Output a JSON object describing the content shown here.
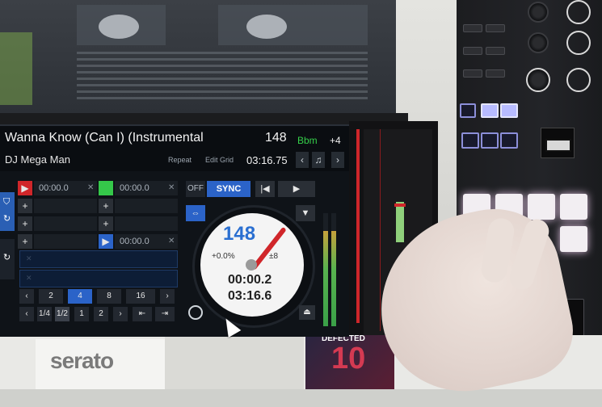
{
  "deck": {
    "track_title": "Wanna Know (Can I) (Instrumental",
    "artist": "DJ Mega Man",
    "bpm": "148",
    "key": "Bbm",
    "key_offset": "+4",
    "repeat_label": "Repeat",
    "edit_grid_label": "Edit Grid",
    "time_remaining": "03:16.75",
    "prev_icon": "‹",
    "note_icon": "♫",
    "next_icon": "›"
  },
  "cues": [
    {
      "time": "00:00.0",
      "color": "#d0262a",
      "icon": "▶"
    },
    {
      "time": "00:00.0",
      "color": "#35c84a",
      "icon": ""
    },
    {
      "time": "",
      "icon": "+"
    },
    {
      "time": "",
      "icon": "+"
    },
    {
      "time": "",
      "icon": "+"
    },
    {
      "time": "",
      "icon": "+"
    },
    {
      "time": "",
      "icon": "+"
    },
    {
      "time": "00:00.0",
      "color": "#2b63c8",
      "icon": "▶"
    }
  ],
  "transport": {
    "off_label": "OFF",
    "sync_label": "SYNC",
    "prev_track_icon": "|◀",
    "play_icon": "▶"
  },
  "platter": {
    "bpm": "148",
    "pitch": "+0.0%",
    "range": "±8",
    "elapsed": "00:00.2",
    "remaining": "03:16.6"
  },
  "beatjump": {
    "row1": [
      "‹",
      "2",
      "4",
      "8",
      "16",
      "›"
    ],
    "row2": [
      "‹",
      "1/4",
      "1/2",
      "1",
      "2",
      "›",
      "⇤",
      "⇥"
    ]
  },
  "eject_icon": "⏏",
  "brand": {
    "serato": "serato",
    "sleeve_text": "DEFECTED",
    "sleeve_num": "10"
  }
}
